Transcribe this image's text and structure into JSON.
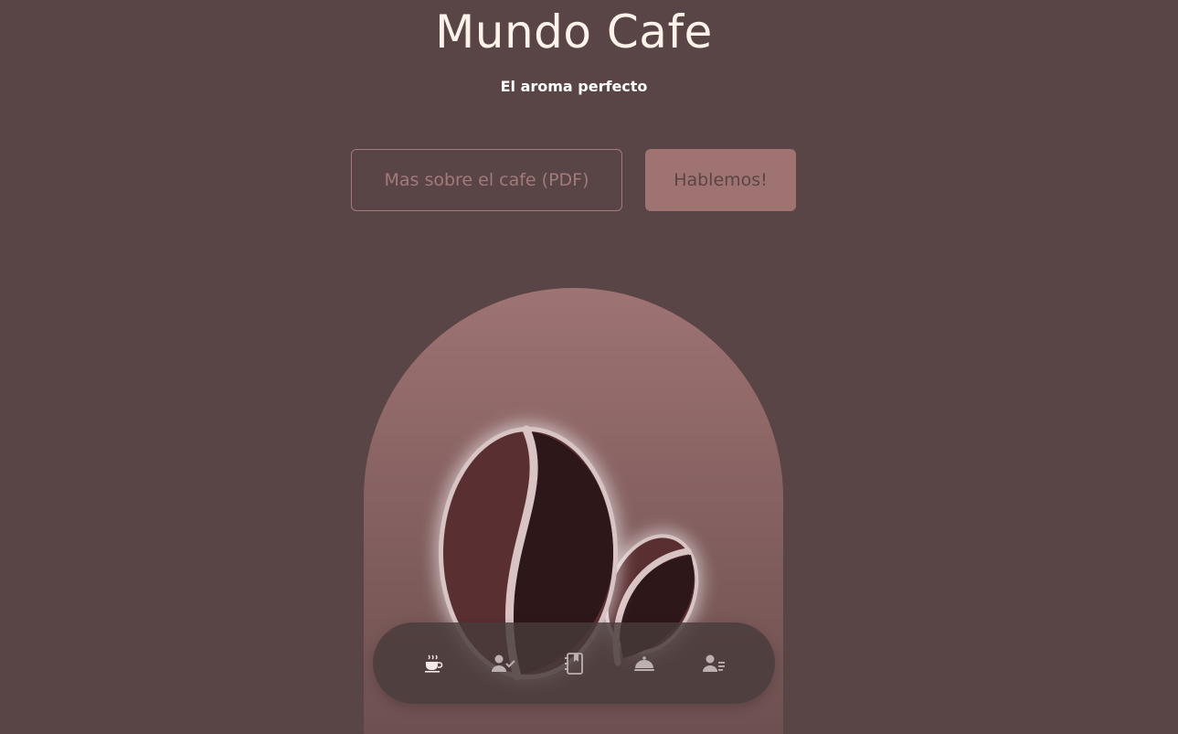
{
  "header": {
    "title": "Mundo Cafe",
    "subtitle": "El aroma perfecto"
  },
  "actions": {
    "pdf_label": "Mas sobre el cafe (PDF)",
    "contact_label": "Hablemos!"
  },
  "nav": {
    "items": [
      {
        "icon": "coffee-cup-icon"
      },
      {
        "icon": "user-check-icon"
      },
      {
        "icon": "address-book-icon"
      },
      {
        "icon": "service-bell-icon"
      },
      {
        "icon": "user-list-icon"
      }
    ]
  },
  "colors": {
    "background": "#5a4546",
    "title": "#fdf3ea",
    "accent": "#a07373",
    "bean_dark": "#2e1718",
    "bean_light": "#5a2f31"
  }
}
